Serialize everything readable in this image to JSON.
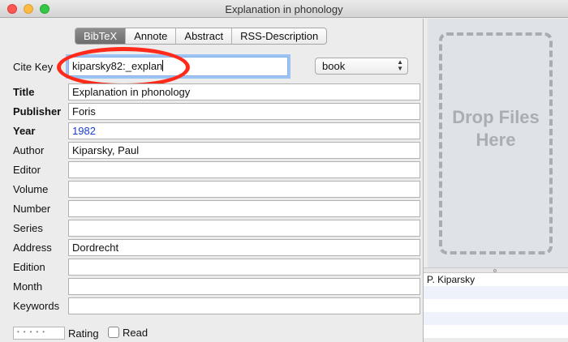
{
  "window": {
    "title": "Explanation in phonology"
  },
  "tabs": [
    "BibTeX",
    "Annote",
    "Abstract",
    "RSS-Description"
  ],
  "cite_key": {
    "label": "Cite Key",
    "value": "kiparsky82:_explan"
  },
  "entry_type": {
    "value": "book"
  },
  "fields": [
    {
      "label": "Title",
      "value": "Explanation in phonology"
    },
    {
      "label": "Publisher",
      "value": "Foris"
    },
    {
      "label": "Year",
      "value": "1982"
    },
    {
      "label": "Author",
      "value": "Kiparsky, Paul"
    },
    {
      "label": "Editor",
      "value": ""
    },
    {
      "label": "Volume",
      "value": ""
    },
    {
      "label": "Number",
      "value": ""
    },
    {
      "label": "Series",
      "value": ""
    },
    {
      "label": "Address",
      "value": "Dordrecht"
    },
    {
      "label": "Edition",
      "value": ""
    },
    {
      "label": "Month",
      "value": ""
    },
    {
      "label": "Keywords",
      "value": ""
    }
  ],
  "bottom": {
    "rating_label": "Rating",
    "read_label": "Read"
  },
  "side": {
    "drop_line1": "Drop Files",
    "drop_line2": "Here",
    "authors": [
      "P. Kiparsky"
    ]
  },
  "colors": {
    "annotation": "#ff2a1a",
    "selected_tab": "#7a7a7a",
    "year_text": "#1a3ccf"
  }
}
